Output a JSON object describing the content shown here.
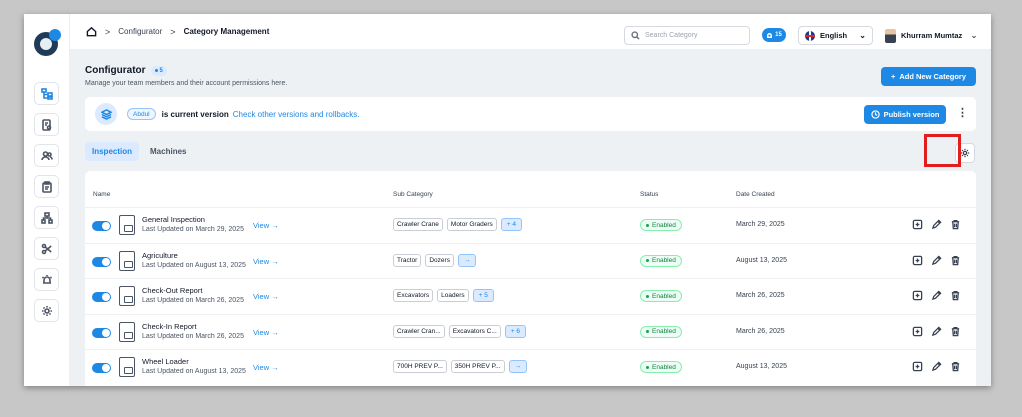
{
  "breadcrumb": {
    "parent": "Configurator",
    "current": "Category Management"
  },
  "search": {
    "placeholder": "Search Category"
  },
  "notifications": {
    "count": "15"
  },
  "language": {
    "selected": "English"
  },
  "user": {
    "name": "Khurram Mumtaz"
  },
  "page": {
    "title": "Configurator",
    "count": "5",
    "subtitle": "Manage your team members and their account permissions here.",
    "add_button": "Add New Category"
  },
  "version": {
    "badge": "Abdul",
    "text": "is current version",
    "link": "Check other versions and rollbacks.",
    "publish": "Publish version"
  },
  "tabs": [
    {
      "label": "Inspection"
    },
    {
      "label": "Machines"
    }
  ],
  "table": {
    "headers": {
      "name": "Name",
      "sub_category": "Sub Category",
      "status": "Status",
      "date_created": "Date Created"
    },
    "view_label": "View",
    "rows": [
      {
        "name": "General Inspection",
        "updated": "Last Updated on March 29, 2025",
        "chips": [
          "Crawler Crane",
          "Motor Graders"
        ],
        "more": "+ 4",
        "status": "Enabled",
        "date": "March 29, 2025"
      },
      {
        "name": "Agriculture",
        "updated": "Last Updated on August 13, 2025",
        "chips": [
          "Tractor",
          "Dozers"
        ],
        "more": "→",
        "status": "Enabled",
        "date": "August 13, 2025"
      },
      {
        "name": "Check-Out Report",
        "updated": "Last Updated on March 26, 2025",
        "chips": [
          "Excavators",
          "Loaders"
        ],
        "more": "+ 5",
        "status": "Enabled",
        "date": "March 26, 2025"
      },
      {
        "name": "Check-In Report",
        "updated": "Last Updated on March 26, 2025",
        "chips": [
          "Crawler Cran...",
          "Excavators C..."
        ],
        "more": "+ 6",
        "status": "Enabled",
        "date": "March 26, 2025"
      },
      {
        "name": "Wheel Loader",
        "updated": "Last Updated on August 13, 2025",
        "chips": [
          "700H PREV P...",
          "350H PREV P..."
        ],
        "more": "→",
        "status": "Enabled",
        "date": "August 13, 2025"
      }
    ]
  },
  "colors": {
    "accent": "#1e88e5",
    "enabled": "#15803d",
    "highlight": "#e11d1d"
  }
}
